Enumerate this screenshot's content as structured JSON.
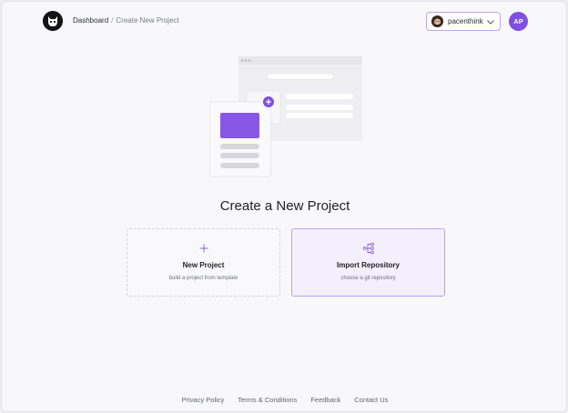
{
  "breadcrumb": {
    "home": "Dashboard",
    "separator": "/",
    "current": "Create New Project"
  },
  "account": {
    "username": "pacenthink"
  },
  "user_avatar": {
    "initials": "AP"
  },
  "main": {
    "heading": "Create a New Project",
    "cards": [
      {
        "title": "New Project",
        "subtitle": "build a project from template",
        "icon": "plus-icon"
      },
      {
        "title": "Import Repository",
        "subtitle": "choose a git repository",
        "icon": "git-branch-icon"
      }
    ]
  },
  "footer": {
    "links": [
      "Privacy Policy",
      "Terms & Conditions",
      "Feedback",
      "Contact Us"
    ]
  },
  "colors": {
    "accent": "#7e4fe0",
    "accent_light": "#f3effc",
    "background": "#f8f8fb"
  }
}
